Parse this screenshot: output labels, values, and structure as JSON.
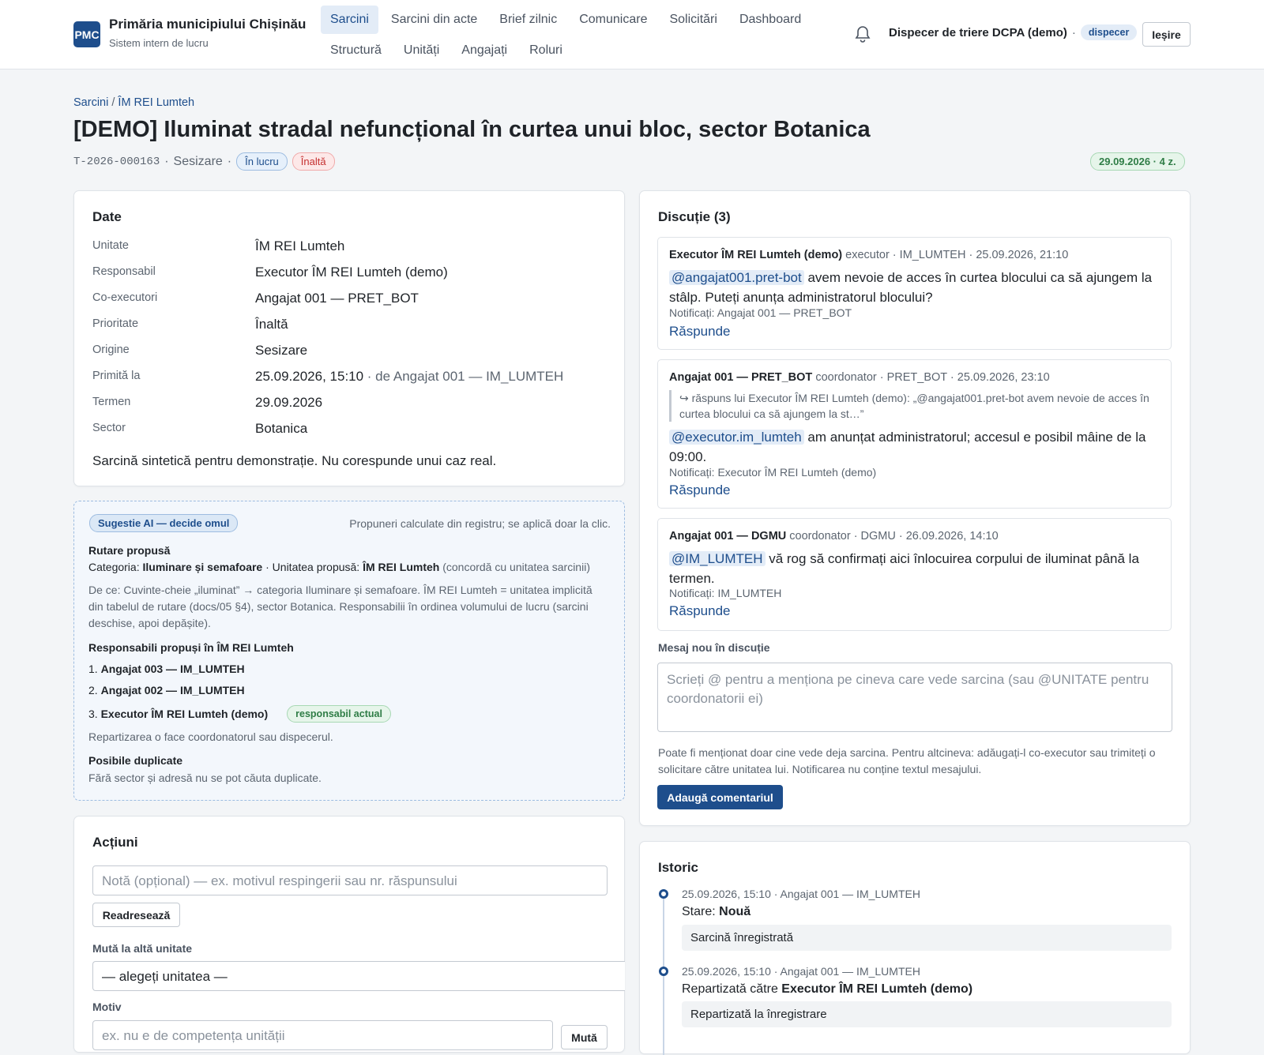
{
  "header": {
    "logo": "PMC",
    "title": "Primăria municipiului Chișinău",
    "subtitle": "Sistem intern de lucru",
    "nav_row1": [
      "Sarcini",
      "Sarcini din acte",
      "Brief zilnic",
      "Comunicare",
      "Solicitări",
      "Dashboard"
    ],
    "nav_row2": [
      "Structură",
      "Unități",
      "Angajați",
      "Roluri"
    ],
    "user_name": "Dispecer de triere DCPA (demo)",
    "separator": "·",
    "user_role": "dispecer",
    "logout": "Ieșire"
  },
  "breadcrumb": {
    "root": "Sarcini",
    "sep": " / ",
    "current": "ÎM REI Lumteh"
  },
  "task": {
    "title": "[DEMO] Iluminat stradal nefuncțional în curtea unui bloc, sector Botanica",
    "id": "T-2026-000163",
    "sep": "·",
    "origin": "Sesizare",
    "status": "În lucru",
    "priority": "Înaltă",
    "due_badge": "29.09.2026 · 4 z."
  },
  "details": {
    "heading": "Date",
    "rows": [
      {
        "k": "Unitate",
        "v": "ÎM REI Lumteh"
      },
      {
        "k": "Responsabil",
        "v": "Executor ÎM REI Lumteh (demo)"
      },
      {
        "k": "Co-executori",
        "v": "Angajat 001 — PRET_BOT"
      },
      {
        "k": "Prioritate",
        "v": "Înaltă"
      },
      {
        "k": "Origine",
        "v": "Sesizare"
      },
      {
        "k": "Primită la",
        "v": "25.09.2026, 15:10",
        "v2": " · de Angajat 001 — IM_LUMTEH"
      },
      {
        "k": "Termen",
        "v": "29.09.2026"
      },
      {
        "k": "Sector",
        "v": "Botanica"
      }
    ],
    "note": "Sarcină sintetică pentru demonstrație. Nu corespunde unui caz real."
  },
  "ai": {
    "label": "Sugestie AI — decide omul",
    "note": "Propuneri calculate din registru; se aplică doar la clic.",
    "routing_title": "Rutare propusă",
    "cat_prefix": "Categoria: ",
    "cat_value": "Iluminare și semafoare",
    "unit_prefix": " · Unitatea propusă: ",
    "unit_value": "ÎM REI Lumteh",
    "unit_suffix": " (concordă cu unitatea sarcinii)",
    "why": "De ce: Cuvinte-cheie „iluminat” → categoria Iluminare și semafoare. ÎM REI Lumteh = unitatea implicită din tabelul de rutare (docs/05 §4), sector Botanica. Responsabilii în ordinea volumului de lucru (sarcini deschise, apoi depășite).",
    "resp_title": "Responsabili propuși în ÎM REI Lumteh",
    "resp": [
      "Angajat 003 — IM_LUMTEH",
      "Angajat 002 — IM_LUMTEH",
      "Executor ÎM REI Lumteh (demo)"
    ],
    "resp_nums": [
      "1.",
      "2.",
      "3."
    ],
    "current_badge": "responsabil actual",
    "assign_note": "Repartizarea o face coordonatorul sau dispecerul.",
    "dup_title": "Posibile duplicate",
    "dup_note": "Fără sector și adresă nu se pot căuta duplicate."
  },
  "actions": {
    "heading": "Acțiuni",
    "note_placeholder": "Notă (opțional) — ex. motivul respingerii sau nr. răspunsului",
    "readdress": "Readresează",
    "move_label": "Mută la altă unitate",
    "select_value": "— alegeți unitatea —",
    "reason_label": "Motiv",
    "reason_placeholder": "ex. nu e de competența unității",
    "move_btn": "Mută"
  },
  "discussion": {
    "heading": "Discuție (3)",
    "comments": [
      {
        "author": "Executor ÎM REI Lumteh (demo)",
        "meta": " executor · IM_LUMTEH · 25.09.2026, 21:10",
        "mention": "@angajat001.pret-bot",
        "text": " avem nevoie de acces în curtea blocului ca să ajungem la stâlp. Puteți anunța administratorul blocului?",
        "notif": "Notificați: Angajat 001 — PRET_BOT",
        "reply": "Răspunde"
      },
      {
        "author": "Angajat 001 — PRET_BOT",
        "meta": " coordonator · PRET_BOT · 25.09.2026, 23:10",
        "quote": "↪ răspuns lui Executor ÎM REI Lumteh (demo): „@angajat001.pret-bot avem nevoie de acces în curtea blocului ca să ajungem la st…”",
        "mention": "@executor.im_lumteh",
        "text": " am anunțat administratorul; accesul e posibil mâine de la 09:00.",
        "notif": "Notificați: Executor ÎM REI Lumteh (demo)",
        "reply": "Răspunde"
      },
      {
        "author": "Angajat 001 — DGMU",
        "meta": " coordonator · DGMU · 26.09.2026, 14:10",
        "mention": "@IM_LUMTEH",
        "text": " vă rog să confirmați aici înlocuirea corpului de iluminat până la termen.",
        "notif": "Notificați: IM_LUMTEH",
        "reply": "Răspunde"
      }
    ],
    "new_label": "Mesaj nou în discuție",
    "placeholder": "Scrieți @ pentru a menționa pe cineva care vede sarcina (sau @UNITATE pentru coordonatorii ei)",
    "hint": "Poate fi menționat doar cine vede deja sarcina. Pentru altcineva: adăugați-l co-executor sau trimiteți o solicitare către unitatea lui. Notificarea nu conține textul mesajului.",
    "submit": "Adaugă comentariul"
  },
  "history": {
    "heading": "Istoric",
    "entries": [
      {
        "meta": "25.09.2026, 15:10 · Angajat 001 — IM_LUMTEH",
        "prefix": "Stare: ",
        "bold": "Nouă",
        "box": "Sarcină înregistrată"
      },
      {
        "meta": "25.09.2026, 15:10 · Angajat 001 — IM_LUMTEH",
        "prefix": "Repartizată către ",
        "bold": "Executor ÎM REI Lumteh (demo)",
        "box": "Repartizată la înregistrare"
      }
    ]
  }
}
